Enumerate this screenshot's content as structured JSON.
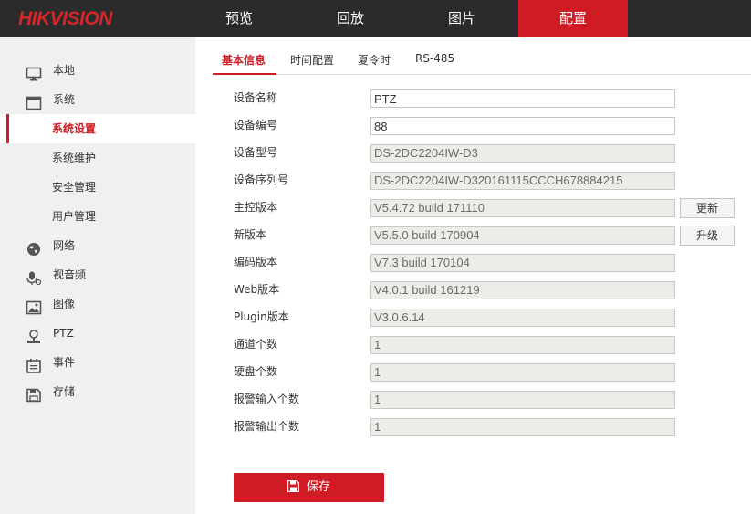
{
  "brand": {
    "logo_hik": "HIK",
    "logo_vision": "VISION"
  },
  "nav": [
    {
      "label": "预览"
    },
    {
      "label": "回放"
    },
    {
      "label": "图片"
    },
    {
      "label": "配置"
    }
  ],
  "sidebar": {
    "items": [
      {
        "label": "本地",
        "icon": "monitor-icon"
      },
      {
        "label": "系统",
        "icon": "window-icon"
      },
      {
        "label": "系统设置"
      },
      {
        "label": "系统维护"
      },
      {
        "label": "安全管理"
      },
      {
        "label": "用户管理"
      },
      {
        "label": "网络",
        "icon": "globe-icon"
      },
      {
        "label": "视音频",
        "icon": "mic-icon"
      },
      {
        "label": "图像",
        "icon": "image-icon"
      },
      {
        "label": "PTZ",
        "icon": "ptz-icon"
      },
      {
        "label": "事件",
        "icon": "calendar-icon"
      },
      {
        "label": "存储",
        "icon": "disk-icon"
      }
    ]
  },
  "tabs": [
    {
      "label": "基本信息"
    },
    {
      "label": "时间配置"
    },
    {
      "label": "夏令时"
    },
    {
      "label": "RS-485"
    }
  ],
  "form": {
    "rows": [
      {
        "label": "设备名称",
        "value": "PTZ"
      },
      {
        "label": "设备编号",
        "value": "88"
      },
      {
        "label": "设备型号",
        "value": "DS-2DC2204IW-D3"
      },
      {
        "label": "设备序列号",
        "value": "DS-2DC2204IW-D320161115CCCH678884215"
      },
      {
        "label": "主控版本",
        "value": "V5.4.72 build 171110"
      },
      {
        "label": "新版本",
        "value": "V5.5.0 build 170904"
      },
      {
        "label": "编码版本",
        "value": "V7.3 build 170104"
      },
      {
        "label": "Web版本",
        "value": "V4.0.1 build 161219"
      },
      {
        "label": "Plugin版本",
        "value": "V3.0.6.14"
      },
      {
        "label": "通道个数",
        "value": "1"
      },
      {
        "label": "硬盘个数",
        "value": "1"
      },
      {
        "label": "报警输入个数",
        "value": "1"
      },
      {
        "label": "报警输出个数",
        "value": "1"
      }
    ],
    "refresh_label": "更新",
    "upgrade_label": "升级",
    "save_label": "保存"
  },
  "colors": {
    "accent": "#cf1b24",
    "topbar": "#2b2b2b",
    "sidebar": "#f0f0f0"
  }
}
